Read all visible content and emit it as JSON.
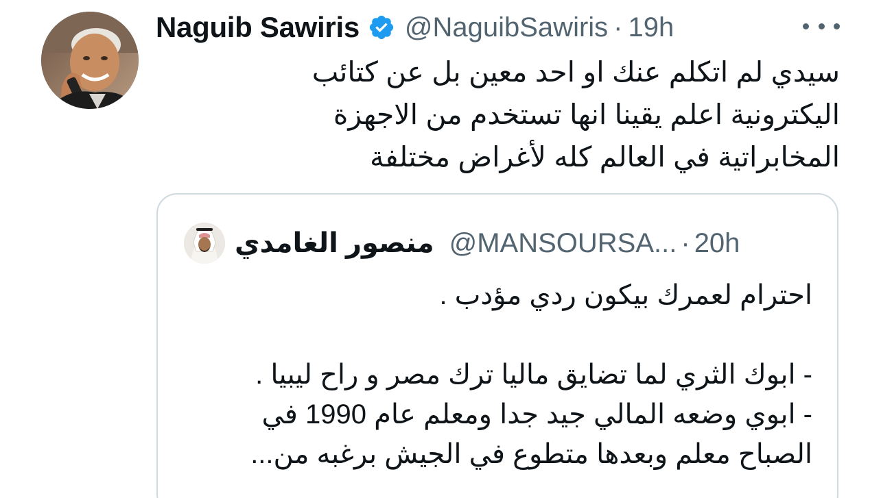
{
  "tweet": {
    "author": {
      "display_name": "Naguib Sawiris",
      "handle": "@NaguibSawiris",
      "verified": true
    },
    "separator": "·",
    "timestamp": "19h",
    "more_icon": "more-horizontal-icon",
    "text_lines": [
      "سيدي لم اتكلم عنك او احد معين بل عن كتائب",
      "اليكترونية اعلم يقينا انها تستخدم من الاجهزة",
      "المخابراتية في العالم كله لأغراض مختلفة"
    ]
  },
  "quoted_tweet": {
    "author": {
      "display_name": "منصور الغامدي",
      "handle": "@MANSOURSA..."
    },
    "separator": "·",
    "timestamp": "20h",
    "text_lines": [
      "احترام لعمرك بيكون ردي مؤدب .",
      "",
      "- ابوك الثري لما تضايق ماليا ترك مصر و راح ليبيا .",
      "- ابوي وضعه المالي جيد جدا ومعلم عام 1990 في",
      "الصباح معلم وبعدها متطوع في الجيش برغبه من..."
    ]
  },
  "colors": {
    "text_primary": "#0f1419",
    "text_secondary": "#536471",
    "verified_blue": "#1d9bf0",
    "border": "#cfd9de"
  }
}
